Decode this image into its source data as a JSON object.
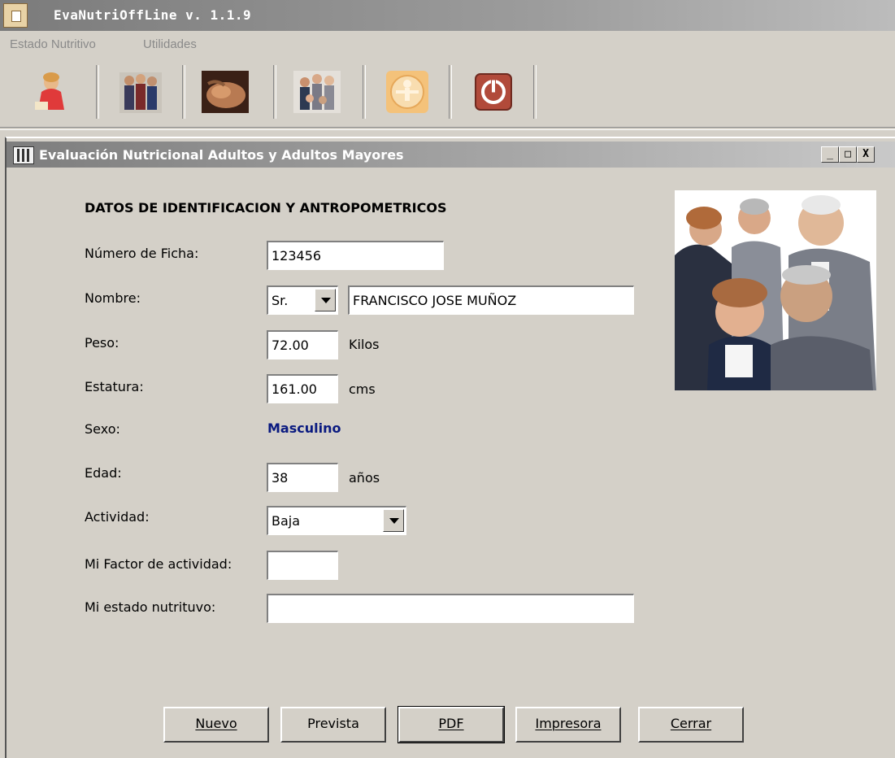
{
  "app": {
    "title": "EvaNutriOffLine  v. 1.1.9"
  },
  "menu": [
    "Estado Nutritivo",
    "Utilidades"
  ],
  "toolbar": {
    "buttons": [
      {
        "name": "child-icon"
      },
      {
        "name": "family-icon"
      },
      {
        "name": "pregnancy-icon"
      },
      {
        "name": "seniors-icon"
      },
      {
        "name": "vitruvian-icon"
      },
      {
        "name": "power-icon"
      }
    ]
  },
  "window": {
    "title": "Evaluación Nutricional Adultos y Adultos Mayores",
    "controls": [
      "_",
      "□",
      "X"
    ]
  },
  "form": {
    "heading": "DATOS DE IDENTIFICACION Y ANTROPOMETRICOS",
    "labels": {
      "ficha": "Número de Ficha:",
      "nombre": "Nombre:",
      "peso": "Peso:",
      "estatura": "Estatura:",
      "sexo": "Sexo:",
      "edad": "Edad:",
      "actividad": "Actividad:",
      "factor": "Mi Factor de actividad:",
      "estado": "Mi estado nutrituvo:"
    },
    "values": {
      "ficha": "123456",
      "tratamiento": "Sr.",
      "nombre": "FRANCISCO JOSE MUÑOZ",
      "peso": "72.00",
      "estatura": "161.00",
      "sexo": "Masculino",
      "edad": "38",
      "actividad": "Baja",
      "factor": "",
      "estado": ""
    },
    "units": {
      "peso": "Kilos",
      "estatura": "cms",
      "edad": "años"
    }
  },
  "buttons": {
    "nuevo": "Nuevo",
    "prevista": "Prevista",
    "pdf": "PDF",
    "impresora": "Impresora",
    "cerrar": "Cerrar"
  }
}
